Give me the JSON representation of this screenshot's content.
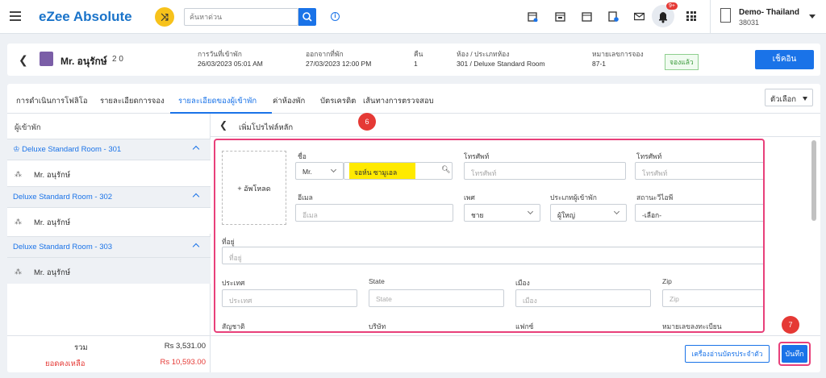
{
  "topbar": {
    "logo": "eZee Absolute",
    "search_placeholder": "ค้นหาด่วน",
    "notification_count": "9+",
    "hotel_name": "Demo- Thailand",
    "hotel_code": "38031"
  },
  "reservation": {
    "guest_name": "Mr. อนุรักษ์",
    "pax": "2   0",
    "arrival_label": "การวันที่เข้าพัก",
    "arrival_value": "26/03/2023 05:01 AM",
    "departure_label": "ออกจากที่พัก",
    "departure_value": "27/03/2023 12:00 PM",
    "nights_label": "คืน",
    "nights_value": "1",
    "room_label": "ห้อง / ประเภทห้อง",
    "room_value": "301 / Deluxe Standard Room",
    "resv_no_label": "หมายเลขการจอง",
    "resv_no_value": "87-1",
    "status": "จองแล้ว",
    "checkin_button": "เช็คอิน"
  },
  "tabs": [
    "การดำเนินการโฟลิโอ",
    "รายละเอียดการจอง",
    "รายละเอียดของผู้เข้าพัก",
    "ค่าห้องพัก",
    "บัตรเครดิต",
    "เส้นทางการตรวจสอบ"
  ],
  "options_button": "ตัวเลือก",
  "sidebar": {
    "title": "ผู้เข้าพัก",
    "rooms": [
      {
        "label": "Deluxe Standard Room - 301",
        "guest": "Mr. อนุรักษ์"
      },
      {
        "label": "Deluxe Standard Room - 302",
        "guest": "Mr. อนุรักษ์"
      },
      {
        "label": "Deluxe Standard Room - 303",
        "guest": "Mr. อนุรักษ์"
      }
    ],
    "total_label": "รวม",
    "total_value": "Rs 3,531.00",
    "balance_label": "ยอดคงเหลือ",
    "balance_value": "Rs 10,593.00"
  },
  "content": {
    "title": "เพิ่มโปรไฟล์หลัก",
    "step6": "6",
    "step7": "7"
  },
  "form": {
    "upload_label": "+ อัพโหลด",
    "name_label": "ชื่อ",
    "salutation": "Mr.",
    "name_value": "จอห์น ซามูเอล",
    "phone_label": "โทรศัพท์",
    "phone_placeholder": "โทรศัพท์",
    "mobile_label": "โทรศัพท์",
    "mobile_placeholder": "โทรศัพท์",
    "email_label": "อีเมล",
    "email_placeholder": "อีเมล",
    "gender_label": "เพศ",
    "gender_value": "ชาย",
    "guest_type_label": "ประเภทผู้เข้าพัก",
    "guest_type_value": "ผู้ใหญ่",
    "vip_label": "สถานะวีไอพี",
    "vip_value": "-เลือก-",
    "address_label": "ที่อยู่",
    "address_placeholder": "ที่อยู่",
    "country_label": "ประเทศ",
    "country_placeholder": "ประเทศ",
    "state_label": "State",
    "state_placeholder": "State",
    "city_label": "เมือง",
    "city_placeholder": "เมือง",
    "zip_label": "Zip",
    "zip_placeholder": "Zip",
    "nationality_label": "สัญชาติ",
    "company_label": "บริษัท",
    "fax_label": "แฟกซ์",
    "reg_no_label": "หมายเลขลงทะเบียน"
  },
  "footer": {
    "id_reader_button": "เครื่องอ่านบัตรประจำตัว",
    "save_button": "บันทึก"
  },
  "colors": {
    "accent": "#1a73e8",
    "highlight": "#ffea00",
    "annotation": "#e8407a",
    "step_badge": "#e53935",
    "balance": "#e53935"
  }
}
